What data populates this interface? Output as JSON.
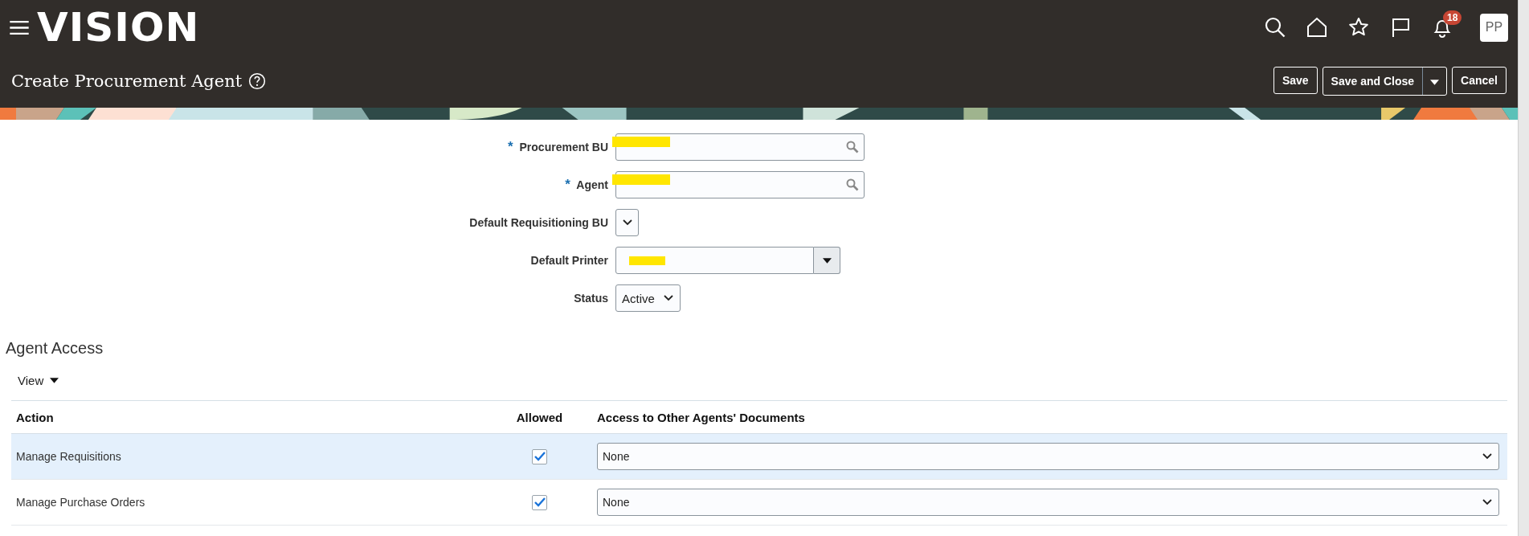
{
  "header": {
    "logo": "VISION",
    "notification_count": "18",
    "avatar": "PP",
    "page_title": "Create Procurement Agent"
  },
  "actions": [
    {
      "label": "Save",
      "kind": "button"
    },
    {
      "label": "Save and Close",
      "kind": "split"
    },
    {
      "label": "Cancel",
      "kind": "button"
    }
  ],
  "form": [
    {
      "required_marker": "*",
      "label": "Procurement BU",
      "kind": "search",
      "redacted": true
    },
    {
      "required_marker": "*",
      "label": "Agent",
      "kind": "search",
      "redacted": true
    },
    {
      "label": "Default Requisitioning BU",
      "kind": "select-small",
      "redacted": false
    },
    {
      "label": "Default Printer",
      "kind": "combo",
      "redacted": true
    },
    {
      "label": "Status",
      "kind": "select",
      "value": "Active",
      "redacted": false
    }
  ],
  "section": {
    "title": "Agent Access",
    "view_menu": "View"
  },
  "table": {
    "columns": [
      "Action",
      "Allowed",
      "Access to Other Agents' Documents"
    ],
    "rows": [
      {
        "action": "Manage Requisitions",
        "allowed": true,
        "access": "None",
        "selected": true
      },
      {
        "action": "Manage Purchase Orders",
        "allowed": true,
        "access": "None",
        "selected": false
      }
    ]
  }
}
